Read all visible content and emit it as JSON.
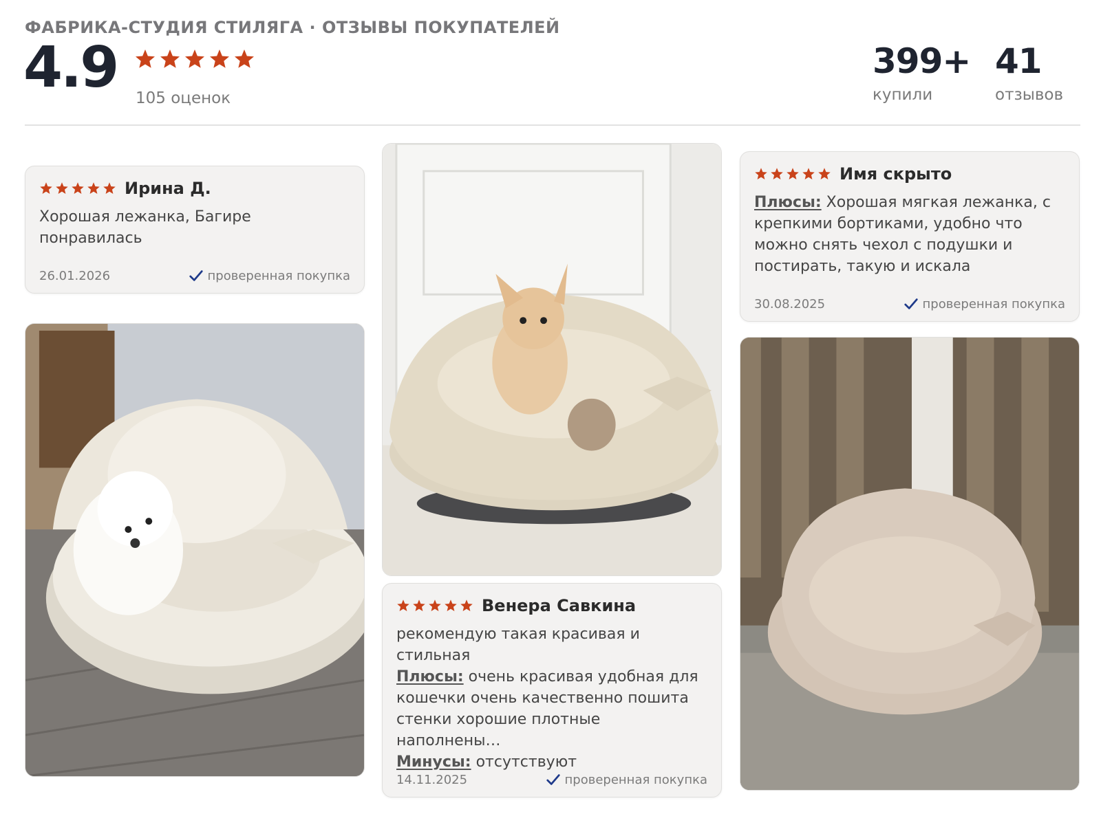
{
  "header": {
    "title": "ФАБРИКА-СТУДИЯ СТИЛЯГА · ОТЗЫВЫ ПОКУПАТЕЛЕЙ",
    "rating": "4.9",
    "rating_stars": 5,
    "rating_count": "105 оценок"
  },
  "stats": [
    {
      "value": "399+",
      "label": "купили"
    },
    {
      "value": "41",
      "label": "отзывов"
    }
  ],
  "reviews": [
    {
      "stars": 5,
      "author": "Ирина Д.",
      "text": "Хорошая лежанка, Багире понравилась",
      "date": "26.01.2026",
      "verified": "проверенная покупка"
    },
    {
      "stars": 5,
      "author": "Имя скрыто",
      "pros_label": "Плюсы:",
      "pros": "Хорошая мягкая лежанка, с крепкими бортиками, удобно что можно снять чехол с подушки и постирать, такую и искала",
      "date": "30.08.2025",
      "verified": "проверенная покупка"
    },
    {
      "stars": 5,
      "author": "Венера Савкина",
      "text": "рекомендую такая красивая и стильная",
      "pros_label": "Плюсы:",
      "pros": "очень красивая удобная для кошечки очень качественно пошита стенки хорошие плотные наполнены…",
      "cons_label": "Минусы:",
      "cons": "отсутствуют",
      "date": "14.11.2025",
      "verified": "проверенная покупка"
    }
  ],
  "colors": {
    "star": "#c9431a",
    "check": "#1e3a8a",
    "bed": "#e9e2d2"
  },
  "icons": [
    "star-icon",
    "check-icon"
  ]
}
